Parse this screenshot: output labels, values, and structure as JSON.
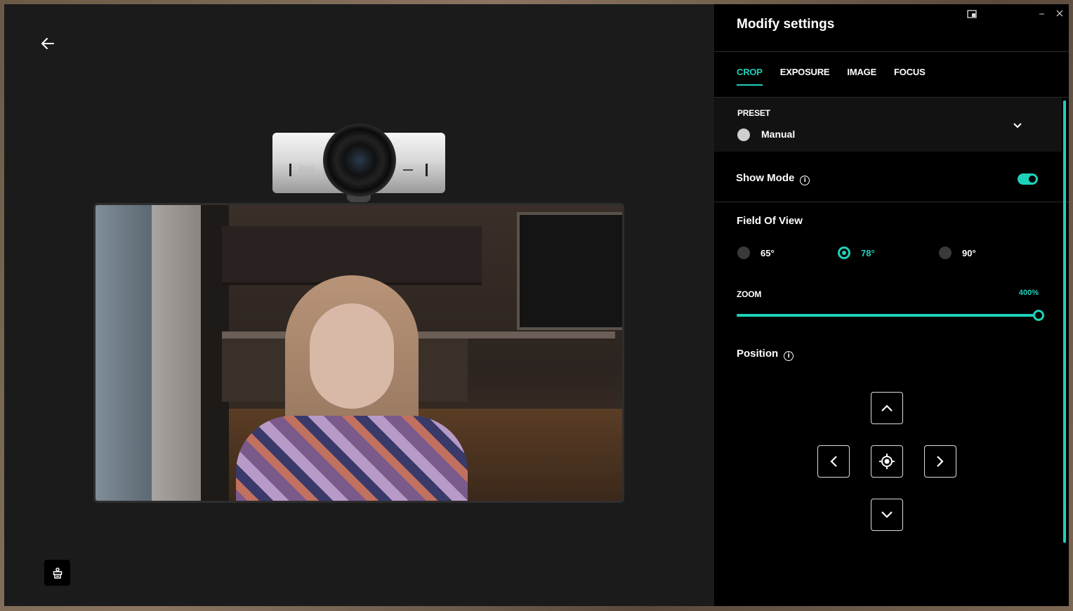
{
  "panel": {
    "title": "Modify settings",
    "tabs": [
      {
        "label": "CROP",
        "active": true
      },
      {
        "label": "EXPOSURE",
        "active": false
      },
      {
        "label": "IMAGE",
        "active": false
      },
      {
        "label": "FOCUS",
        "active": false
      }
    ],
    "preset": {
      "label": "PRESET",
      "value": "Manual"
    },
    "show_mode": {
      "label": "Show Mode",
      "enabled": true
    },
    "field_of_view": {
      "label": "Field Of View",
      "options": [
        "65°",
        "78°",
        "90°"
      ],
      "selected": "78°"
    },
    "zoom": {
      "label": "ZOOM",
      "value_text": "400%",
      "fraction": 1.0
    },
    "position": {
      "label": "Position"
    }
  },
  "camera": {
    "logo_text": "logi"
  },
  "icons": {
    "back": "arrow-left-icon",
    "bottom": "webcam-stand-icon",
    "chevron": "chevron-down-icon",
    "info": "info-icon",
    "center": "crosshair-icon"
  },
  "colors": {
    "accent": "#1fd1b9",
    "panel_bg": "#000000",
    "stage_bg": "#1b1b1b"
  }
}
